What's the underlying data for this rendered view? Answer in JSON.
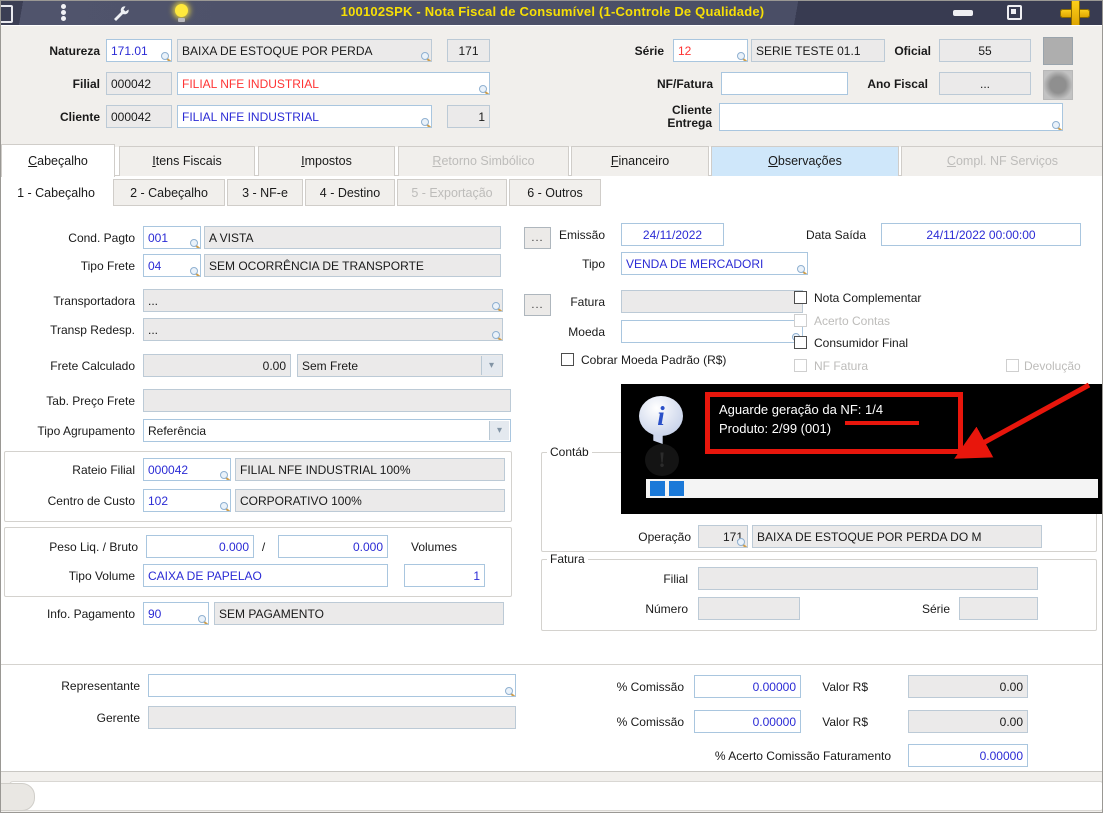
{
  "window": {
    "title": "100102SPK - Nota Fiscal de Consumível (1-Controle De Qualidade)"
  },
  "colors": {
    "title_text": "#f7df05",
    "field_border": "#a9c6df",
    "value_blue": "#2b2bd5",
    "alert_red": "#ff3434",
    "annotation_red": "#e8160c",
    "progress_blue": "#1b79d8",
    "titlebar": "#4a4e66"
  },
  "ui": {
    "ellipsis": "...",
    "slash": "/"
  },
  "header": {
    "natureza": {
      "label": "Natureza",
      "code": "171.01",
      "desc": "BAIXA DE ESTOQUE POR PERDA",
      "num": "171"
    },
    "serie": {
      "label": "Série",
      "code": "12",
      "desc": "SERIE TESTE 01.1"
    },
    "oficial": {
      "label": "Oficial",
      "value": "55"
    },
    "filial": {
      "label": "Filial",
      "code": "000042",
      "desc": "FILIAL NFE INDUSTRIAL"
    },
    "nf_fatura": {
      "label": "NF/Fatura",
      "value": ""
    },
    "ano_fiscal": {
      "label": "Ano Fiscal",
      "value": "..."
    },
    "cliente": {
      "label": "Cliente",
      "code": "000042",
      "desc": "FILIAL NFE INDUSTRIAL",
      "loja": "1"
    },
    "cliente_entrega": {
      "label": "Cliente Entrega",
      "value": ""
    }
  },
  "tabs": {
    "main": [
      {
        "label": "Cabeçalho",
        "state": "active"
      },
      {
        "label": "Itens Fiscais",
        "state": "normal"
      },
      {
        "label": "Impostos",
        "state": "normal"
      },
      {
        "label": "Retorno Simbólico",
        "state": "disabled"
      },
      {
        "label": "Financeiro",
        "state": "normal"
      },
      {
        "label": "Observações",
        "state": "highlight"
      },
      {
        "label": "Compl. NF Serviços",
        "state": "disabled"
      }
    ],
    "sub": [
      {
        "label": "1 - Cabeçalho",
        "state": "active"
      },
      {
        "label": "2 - Cabeçalho",
        "state": "normal"
      },
      {
        "label": "3 - NF-e",
        "state": "normal"
      },
      {
        "label": "4 - Destino",
        "state": "normal"
      },
      {
        "label": "5 - Exportação",
        "state": "disabled"
      },
      {
        "label": "6 - Outros",
        "state": "normal"
      }
    ]
  },
  "form": {
    "left": {
      "cond_pagto": {
        "label": "Cond. Pagto",
        "code": "001",
        "desc": "A VISTA"
      },
      "tipo_frete": {
        "label": "Tipo Frete",
        "code": "04",
        "desc": "SEM OCORRÊNCIA DE TRANSPORTE"
      },
      "transportadora": {
        "label": "Transportadora",
        "value": "..."
      },
      "transp_redesp": {
        "label": "Transp Redesp.",
        "value": "..."
      },
      "frete_calculado": {
        "label": "Frete Calculado",
        "value": "0.00",
        "tipo": "Sem Frete"
      },
      "tab_preco_frete": {
        "label": "Tab. Preço Frete",
        "value": ""
      },
      "tipo_agrupamento": {
        "label": "Tipo Agrupamento",
        "value": "Referência"
      },
      "rateio_filial": {
        "label": "Rateio  Filial",
        "code": "000042",
        "desc": "FILIAL NFE INDUSTRIAL 100%"
      },
      "centro_custo": {
        "label": "Centro de Custo",
        "code": "102",
        "desc": "CORPORATIVO 100%"
      },
      "peso": {
        "label": "Peso Liq. / Bruto",
        "liq": "0.000",
        "bruto": "0.000",
        "volumes_label": "Volumes"
      },
      "tipo_volume": {
        "label": "Tipo Volume",
        "value": "CAIXA DE PAPELAO",
        "qty": "1"
      },
      "info_pagamento": {
        "label": "Info. Pagamento",
        "code": "90",
        "desc": "SEM PAGAMENTO"
      }
    },
    "right": {
      "emissao": {
        "label": "Emissão",
        "value": "24/11/2022"
      },
      "data_saida": {
        "label": "Data Saída",
        "value": "24/11/2022 00:00:00"
      },
      "tipo": {
        "label": "Tipo",
        "value": "VENDA DE MERCADORI"
      },
      "fatura": {
        "label": "Fatura",
        "value": ""
      },
      "moeda": {
        "label": "Moeda",
        "value": ""
      },
      "checks": {
        "cobrar_moeda": {
          "label": "Cobrar Moeda Padrão (R$)",
          "checked": false,
          "disabled": false
        },
        "nota_complementar": {
          "label": "Nota Complementar",
          "checked": false,
          "disabled": false
        },
        "acerto_contas": {
          "label": "Acerto Contas",
          "checked": false,
          "disabled": true
        },
        "consumidor_final": {
          "label": "Consumidor Final",
          "checked": false,
          "disabled": false
        },
        "nf_fatura": {
          "label": "NF Fatura",
          "checked": false,
          "disabled": true
        },
        "devolucao": {
          "label": "Devolução",
          "checked": false,
          "disabled": true
        }
      },
      "contabil": {
        "label": "Contáb"
      },
      "operacao": {
        "label": "Operação",
        "code": "171",
        "desc": "BAIXA DE ESTOQUE POR PERDA DO M"
      },
      "fatura_group": {
        "label": "Fatura",
        "filial_label": "Filial",
        "filial_value": "",
        "numero_label": "Número",
        "numero_value": "",
        "serie_label": "Série",
        "serie_value": ""
      }
    },
    "bottom": {
      "representante": {
        "label": "Representante",
        "value": ""
      },
      "gerente": {
        "label": "Gerente",
        "value": ""
      },
      "comissao1": {
        "label": "% Comissão",
        "pct": "0.00000",
        "valor_label": "Valor R$",
        "valor": "0.00"
      },
      "comissao2": {
        "label": "% Comissão",
        "pct": "0.00000",
        "valor_label": "Valor R$",
        "valor": "0.00"
      },
      "acerto_comissao": {
        "label": "% Acerto Comissão Faturamento",
        "value": "0.00000"
      }
    }
  },
  "popup": {
    "line1": "Aguarde geração da NF: 1/4",
    "line2": "Produto: 2/99 (001)",
    "info_glyph": "i",
    "reflect_glyph": "!"
  }
}
